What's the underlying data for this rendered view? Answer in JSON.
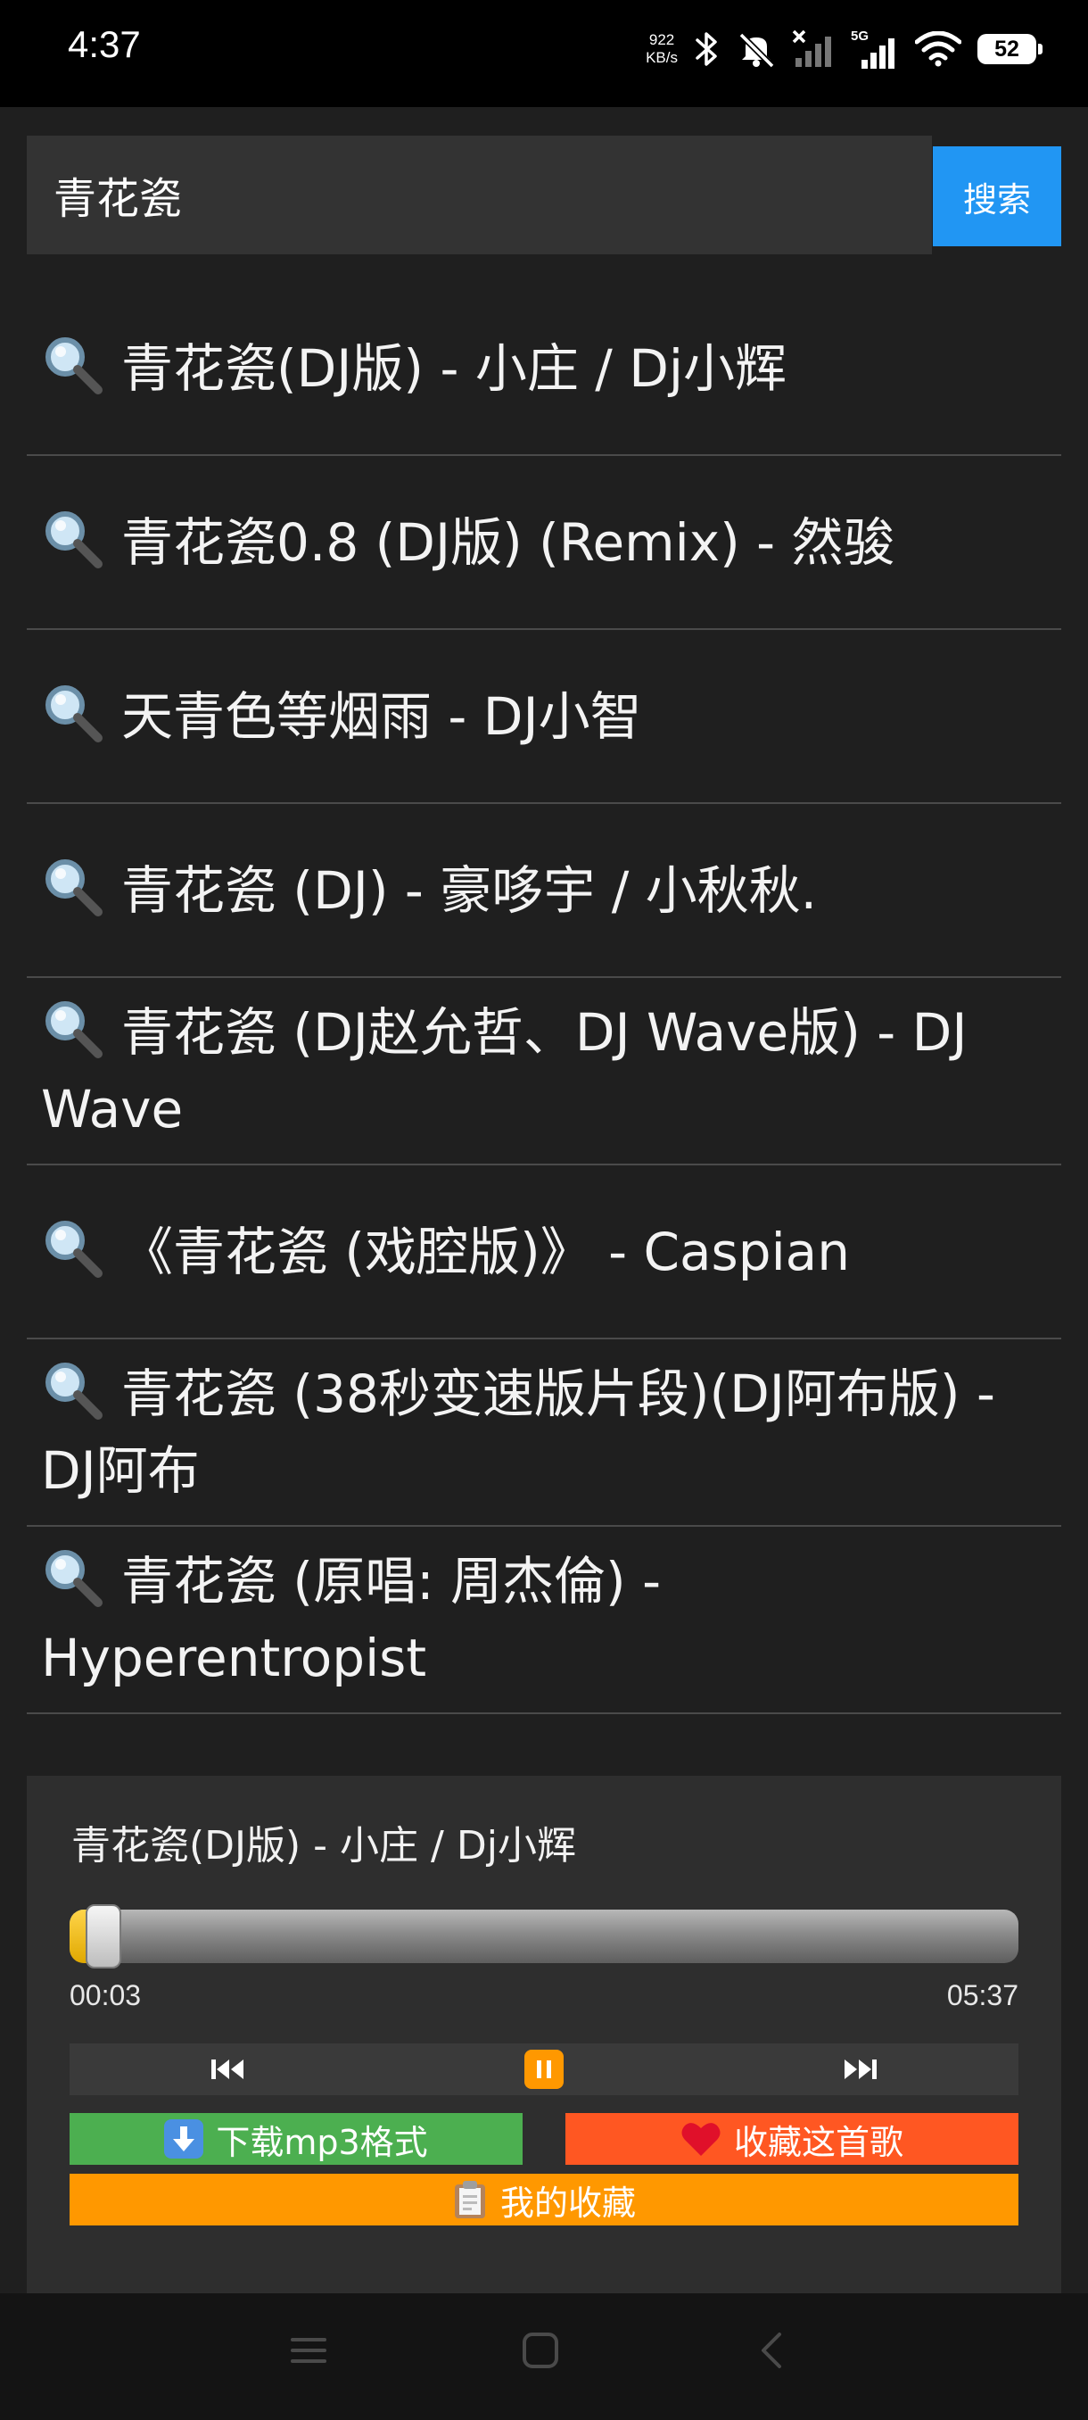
{
  "status_bar": {
    "time": "4:37",
    "net_speed_value": "922",
    "net_speed_unit": "KB/s",
    "network_type": "5G",
    "battery": "52",
    "icons": [
      "bluetooth-icon",
      "mute-icon",
      "no-signal-icon",
      "signal-icon",
      "wifi-icon",
      "battery-icon"
    ]
  },
  "search": {
    "query": "青花瓷",
    "button_label": "搜索"
  },
  "results": [
    {
      "text": "青花瓷(DJ版) - 小庄 / Dj小辉"
    },
    {
      "text": "青花瓷0.8 (DJ版) (Remix) - 然骏"
    },
    {
      "text": "天青色等烟雨 - DJ小智"
    },
    {
      "text": "青花瓷 (DJ) - 豪哆宇 / 小秋秋."
    },
    {
      "text": "青花瓷 (DJ赵允哲、DJ Wave版) - DJ Wave"
    },
    {
      "text": "《青花瓷 (戏腔版)》 - Caspian"
    },
    {
      "text": "青花瓷 (38秒变速版片段)(DJ阿布版) - DJ阿布"
    },
    {
      "text": "青花瓷 (原唱: 周杰倫) - Hyperentropist"
    }
  ],
  "player": {
    "title": "青花瓷(DJ版) - 小庄 / Dj小辉",
    "current_time": "00:03",
    "total_time": "05:37",
    "progress_fraction": 0.009,
    "controls": {
      "prev_icon": "skip-previous-icon",
      "pause_icon": "pause-icon",
      "next_icon": "skip-next-icon"
    },
    "download_label": "下载mp3格式",
    "favorite_label": "收藏这首歌",
    "my_favorites_label": "我的收藏"
  },
  "nav_bar": {
    "icons": [
      "menu-icon",
      "home-icon",
      "back-icon"
    ]
  },
  "colors": {
    "search_button": "#2196f3",
    "download": "#4caf50",
    "favorite": "#ff5722",
    "my_favorites": "#ff9800",
    "progress_fill": "#ffc107"
  }
}
